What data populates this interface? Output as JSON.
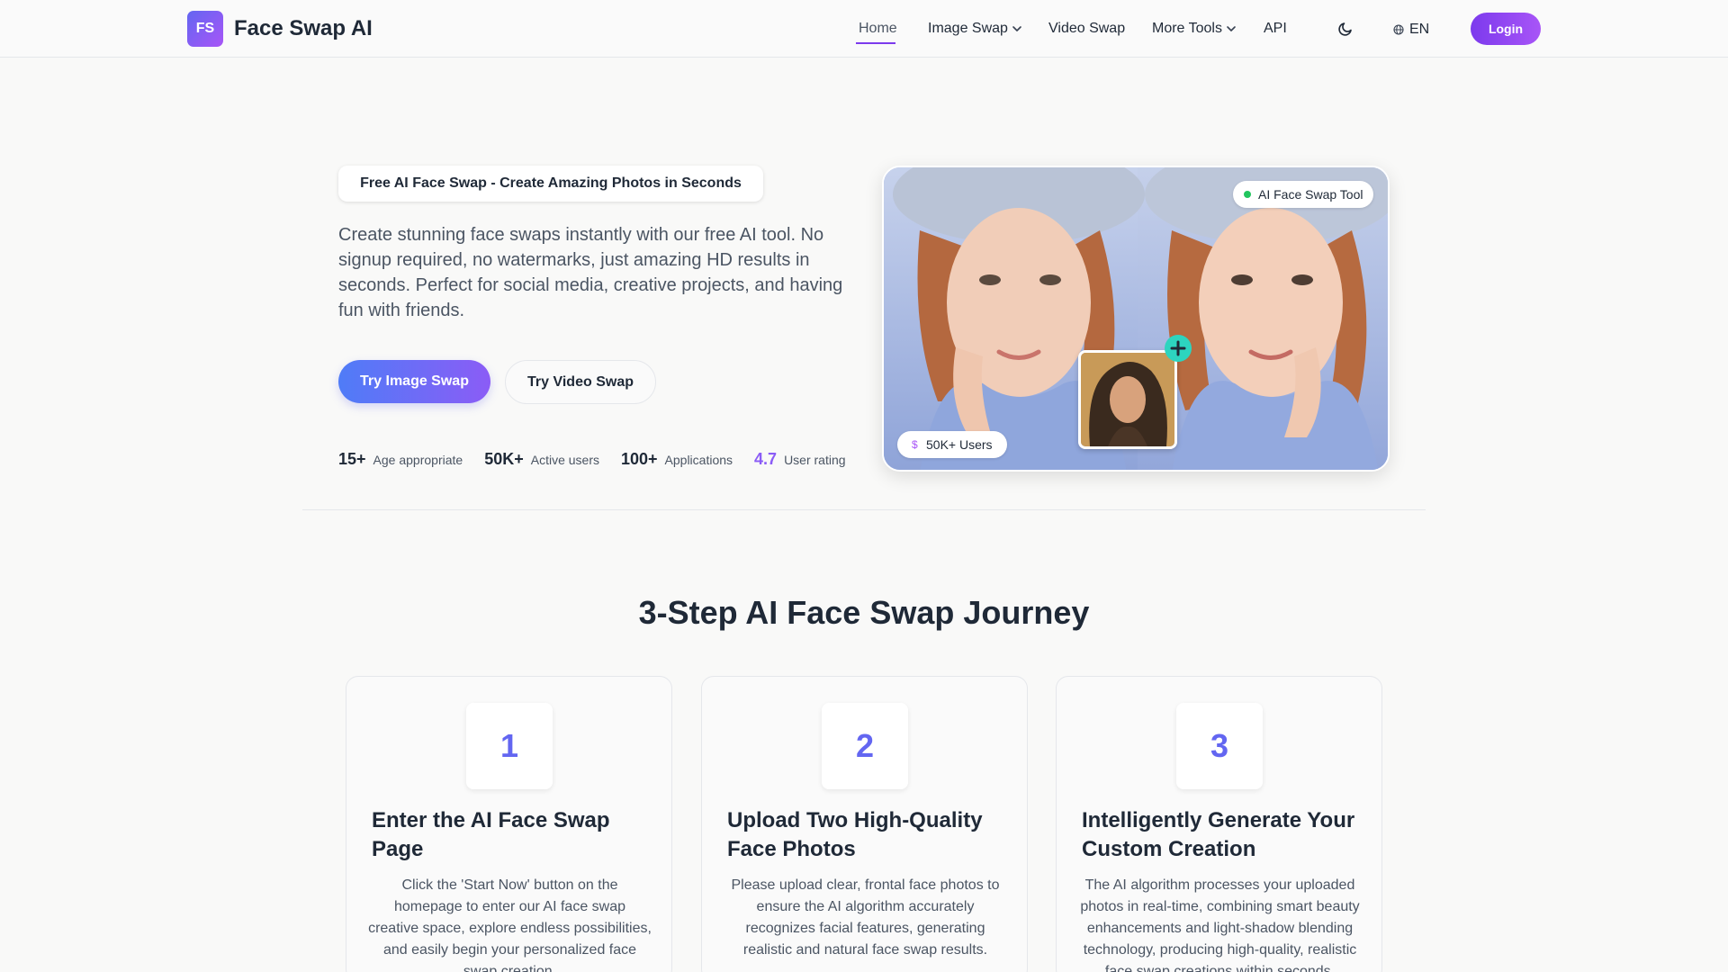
{
  "header": {
    "logo_badge": "FS",
    "logo_text": "Face Swap AI",
    "nav": {
      "home": "Home",
      "image_swap": "Image Swap",
      "video_swap": "Video Swap",
      "more_tools": "More Tools",
      "api": "API"
    },
    "lang": "EN",
    "login": "Login"
  },
  "hero": {
    "badge": "Free AI Face Swap - Create Amazing Photos in Seconds",
    "description": "Create stunning face swaps instantly with our free AI tool. No signup required, no watermarks, just amazing HD results in seconds. Perfect for social media, creative projects, and having fun with friends.",
    "primary_button": "Try Image Swap",
    "secondary_button": "Try Video Swap",
    "stats": [
      {
        "value": "15+",
        "label": "Age appropriate"
      },
      {
        "value": "50K+",
        "label": "Active users"
      },
      {
        "value": "100+",
        "label": "Applications"
      },
      {
        "value": "4.7",
        "label": "User rating"
      }
    ],
    "tool_pill": "AI Face Swap Tool",
    "users_pill": "50K+ Users",
    "users_pill_icon": "$"
  },
  "steps": {
    "title": "3-Step AI Face Swap Journey",
    "items": [
      {
        "number": "1",
        "title": "Enter the AI Face Swap Page",
        "description": "Click the 'Start Now' button on the homepage to enter our AI face swap creative space, explore endless possibilities, and easily begin your personalized face swap creation."
      },
      {
        "number": "2",
        "title": "Upload Two High-Quality Face Photos",
        "description": "Please upload clear, frontal face photos to ensure the AI algorithm accurately recognizes facial features, generating realistic and natural face swap results."
      },
      {
        "number": "3",
        "title": "Intelligently Generate Your Custom Creation",
        "description": "The AI algorithm processes your uploaded photos in real-time, combining smart beauty enhancements and light-shadow blending technology, producing high-quality, realistic face swap creations within seconds."
      }
    ]
  },
  "colors": {
    "accent": "#7c3aed",
    "brand_gradient_start": "#4f7cf7",
    "brand_gradient_end": "#8b5cf6",
    "rating": "#8b5cf6",
    "online": "#22c55e"
  },
  "icons": {
    "theme_toggle": "moon-icon",
    "language": "globe-icon",
    "dropdown": "chevron-down-icon",
    "add": "plus-icon"
  }
}
